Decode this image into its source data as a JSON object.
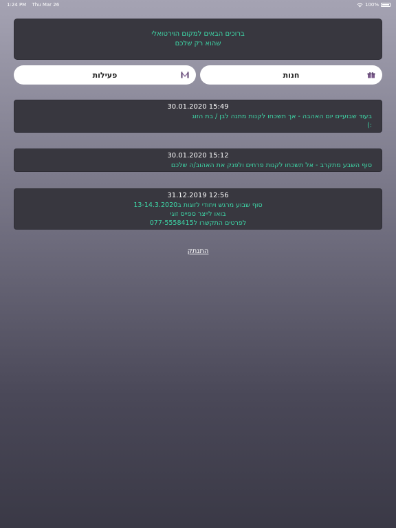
{
  "status_bar": {
    "time": "1:24 PM",
    "date": "Thu Mar 26",
    "battery": "100%"
  },
  "welcome": {
    "line1": "ברוכים הבאים למקום הוירטואלי",
    "line2": "שהוא רק שלכם"
  },
  "nav": {
    "shop_label": "חנות",
    "activities_label": "פעילות"
  },
  "posts": [
    {
      "date": "30.01.2020 15:49",
      "lines": [
        "בעוד שבועיים יום האהבה - אך תשכחו לקנות מתנה לבן / בת הזוג",
        ":)"
      ]
    },
    {
      "date": "30.01.2020 15:12",
      "lines": [
        "סוף השבע מתקרב - אל תשכחו לקנות פרחים ולפנק את האהוב/ה שלכם"
      ]
    },
    {
      "date": "31.12.2019 12:56",
      "lines": [
        "סוף שבוע מרגש ויחודי לזוגות ב13-14.3.2020",
        "בואו לייצר ספייס זוגי",
        "לפרטים התקשרו ל077-5558415"
      ]
    }
  ],
  "logout_label": "התנתק",
  "colors": {
    "accent": "#3ed8a8",
    "card": "#38373f"
  }
}
